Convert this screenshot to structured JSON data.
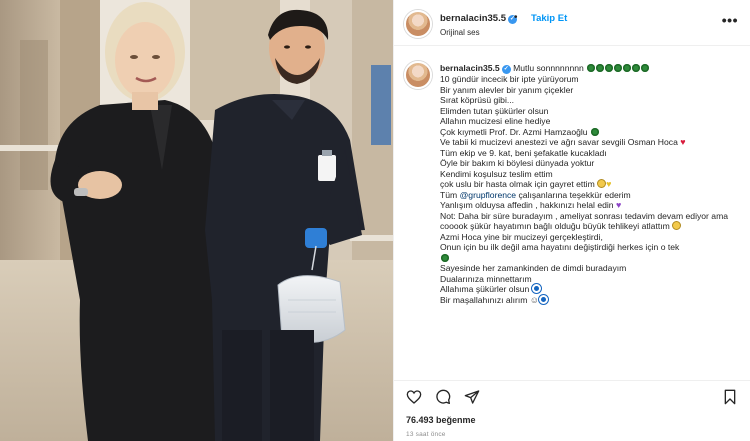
{
  "post": {
    "username": "bernalacin35.5",
    "verified_badge": "verified-icon",
    "separator": "•",
    "follow_label": "Takip Et",
    "audio_label": "Orijinal ses",
    "more_label": "•••",
    "likes": "76.493 beğenme",
    "time_ago": "13 saat önce"
  },
  "caption": {
    "username": "bernalacin35.5",
    "lines": [
      "Mutlu sonnnnnnnn",
      "10 gündür incecik bir ipte yürüyorum",
      "Bir yanım alevler bir yanım çiçekler",
      "Sırat köprüsü gibi...",
      "Elimden tutan şükürler olsun",
      "Allahın mucizesi eline hediye",
      "Çok kıymetli Prof. Dr. Azmi Hamzaoğlu",
      "Ve tabii ki mucizevi anestezi ve ağrı savar sevgili Osman Hoca",
      "Tüm ekip ve 9. kat, beni şefakatle kucakladı",
      "Öyle bir bakım ki böylesi dünyada yoktur",
      "Kendimi koşulsuz teslim ettim",
      "çok uslu bir hasta olmak için gayret ettim",
      "çalışanlarına teşekkür ederim",
      "Yanlışım olduysa affedin , hakkınızı helal edin",
      "Not: Daha bir süre buradayım , ameliyat sonrası tedavim devam ediyor ama cooook şükür hayatımın bağlı olduğu büyük tehlikeyi atlattım",
      "Azmi Hoca yine bir mucizeyi gerçekleştirdi,",
      "Onun için bu ilk değil ama hayatını değiştirdiği herkes için o tek",
      "Sayesinde her zamankinden de dimdi buradayım",
      "Dualarınıza minnettarım",
      "Allahıma şükürler olsun",
      "Bir maşallahınızı alırım"
    ],
    "line12_prefix": "Tüm",
    "mention": "@grupflorence"
  },
  "colors": {
    "accent": "#0095f6",
    "verified": "#3897f0",
    "text": "#262626",
    "muted": "#8e8e8e",
    "mention": "#00376b"
  },
  "icons": [
    "heart-outline-icon",
    "comment-icon",
    "share-icon",
    "bookmark-icon",
    "clover-icon",
    "red-heart-icon",
    "yellow-heart-icon",
    "purple-heart-icon",
    "evil-eye-icon",
    "smile-face-icon"
  ]
}
